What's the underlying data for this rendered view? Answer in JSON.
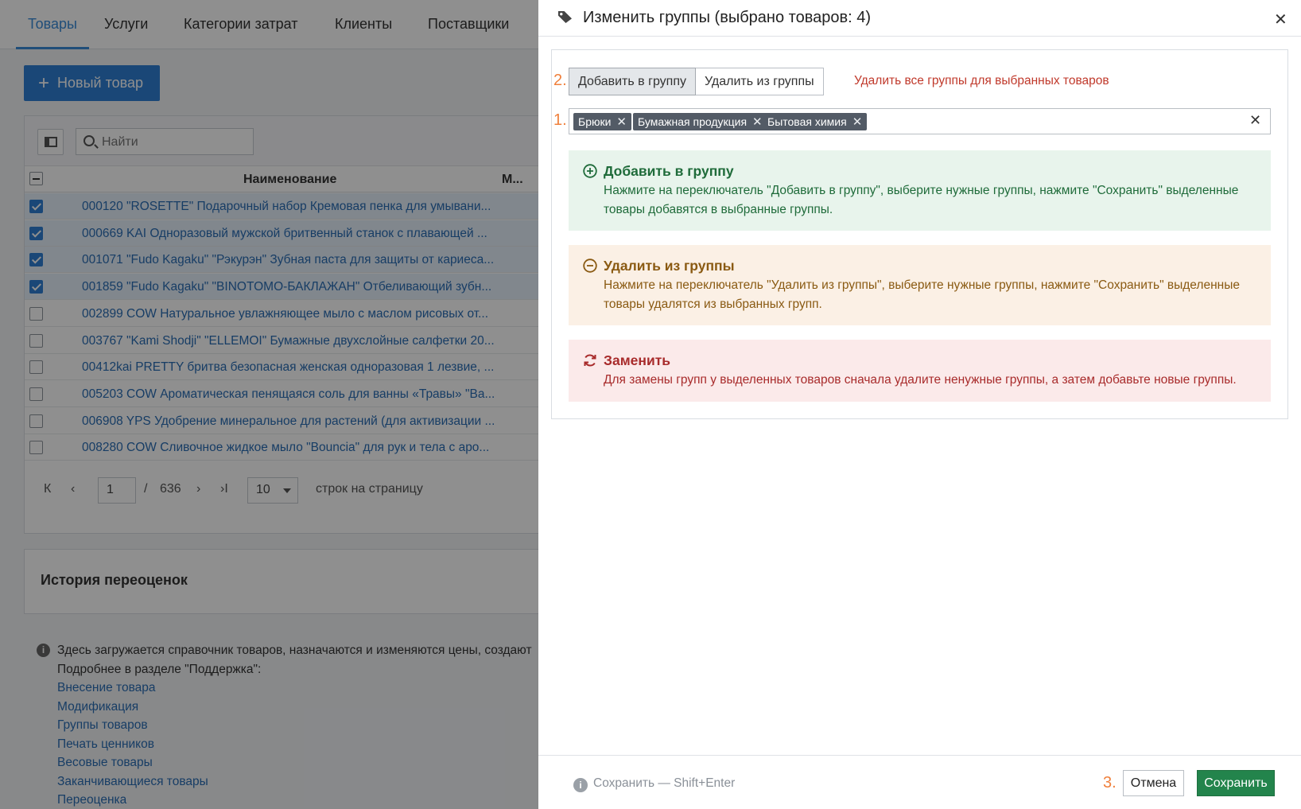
{
  "background": {
    "tabs": [
      "Товары",
      "Услуги",
      "Категории затрат",
      "Клиенты",
      "Поставщики"
    ],
    "new_button": "Новый товар",
    "search_placeholder": "Найти",
    "columns": {
      "name": "Наименование",
      "m": "М..."
    },
    "rows": [
      {
        "text": "000120 \"ROSETTE\" Подарочный набор Кремовая пенка для умывани...",
        "checked": true
      },
      {
        "text": "000669 KAI Одноразовый мужской бритвенный станок с плавающей ...",
        "checked": true
      },
      {
        "text": "001071 \"Fudo Kagaku\" \"Рэкурэн\" Зубная паста для защиты от кариеса...",
        "checked": true
      },
      {
        "text": "001859 \"Fudo Kagaku\" \"BINOTOMO-БАКЛАЖАН\" Отбеливающий зубн...",
        "checked": true
      },
      {
        "text": "002899 COW Натуральное увлажняющее мыло с маслом рисовых от...",
        "checked": false
      },
      {
        "text": "003767 \"Kami Shodji\" \"ELLEMOI\" Бумажные двухслойные салфетки 20...",
        "checked": false
      },
      {
        "text": "00412kai PRETTY бритва безопасная женская одноразовая 1 лезвие, ...",
        "checked": false
      },
      {
        "text": "005203 COW Ароматическая пенящаяся соль для ванны «Травы» \"Ва...",
        "checked": false
      },
      {
        "text": "006908 YPS Удобрение минеральное для растений (для активизации ...",
        "checked": false
      },
      {
        "text": "008280 COW Сливочное жидкое мыло \"Bouncia\" для рук и тела с аро...",
        "checked": false
      }
    ],
    "pager": {
      "first": "К",
      "prev": "‹",
      "page": "1",
      "separator": "/",
      "total": "636",
      "next": "›",
      "last": "›I",
      "page_size": "10",
      "page_size_label": "строк на страницу"
    },
    "history_title": "История переоценок",
    "info": {
      "text": "Здесь загружается справочник товаров, назначаются и изменяются цены, создают",
      "more": "Подробнее в разделе \"Поддержка\":",
      "links": [
        "Внесение товара",
        "Модификация",
        "Группы товаров",
        "Печать ценников",
        "Весовые товары",
        "Заканчивающиеся товары",
        "Переоценка"
      ]
    }
  },
  "panel": {
    "title": "Изменить группы (выбрано товаров: 4)",
    "close": "✕",
    "steps": {
      "one": "1.",
      "two": "2.",
      "three": "3."
    },
    "toggle": {
      "add": "Добавить в группу",
      "remove": "Удалить из группы"
    },
    "remove_all": "Удалить все группы для выбранных товаров",
    "tags": [
      "Брюки",
      "Бумажная продукция",
      "Бытовая химия"
    ],
    "tag_remove": "✕",
    "tags_clear": "✕",
    "notes": {
      "add": {
        "title": "Добавить в группу",
        "text": "Нажмите на переключатель \"Добавить в группу\", выберите нужные группы, нажмите \"Сохранить\" выделенные товары добавятся в выбранные группы."
      },
      "remove": {
        "title": "Удалить из группы",
        "text": "Нажмите на переключатель \"Удалить из группы\", выберите нужные группы, нажмите \"Сохранить\" выделенные товары удалятся из выбранных групп."
      },
      "replace": {
        "title": "Заменить",
        "text": "Для замены групп у выделенных товаров сначала удалите ненужные группы, а затем добавьте новые группы."
      }
    },
    "footer": {
      "hint": "Сохранить — Shift+Enter",
      "cancel": "Отмена",
      "save": "Сохранить"
    }
  },
  "colors": {
    "accent_blue": "#2f7fd4",
    "save_green": "#23844c",
    "step_orange": "#f0803c",
    "danger_red": "#c0392b"
  }
}
